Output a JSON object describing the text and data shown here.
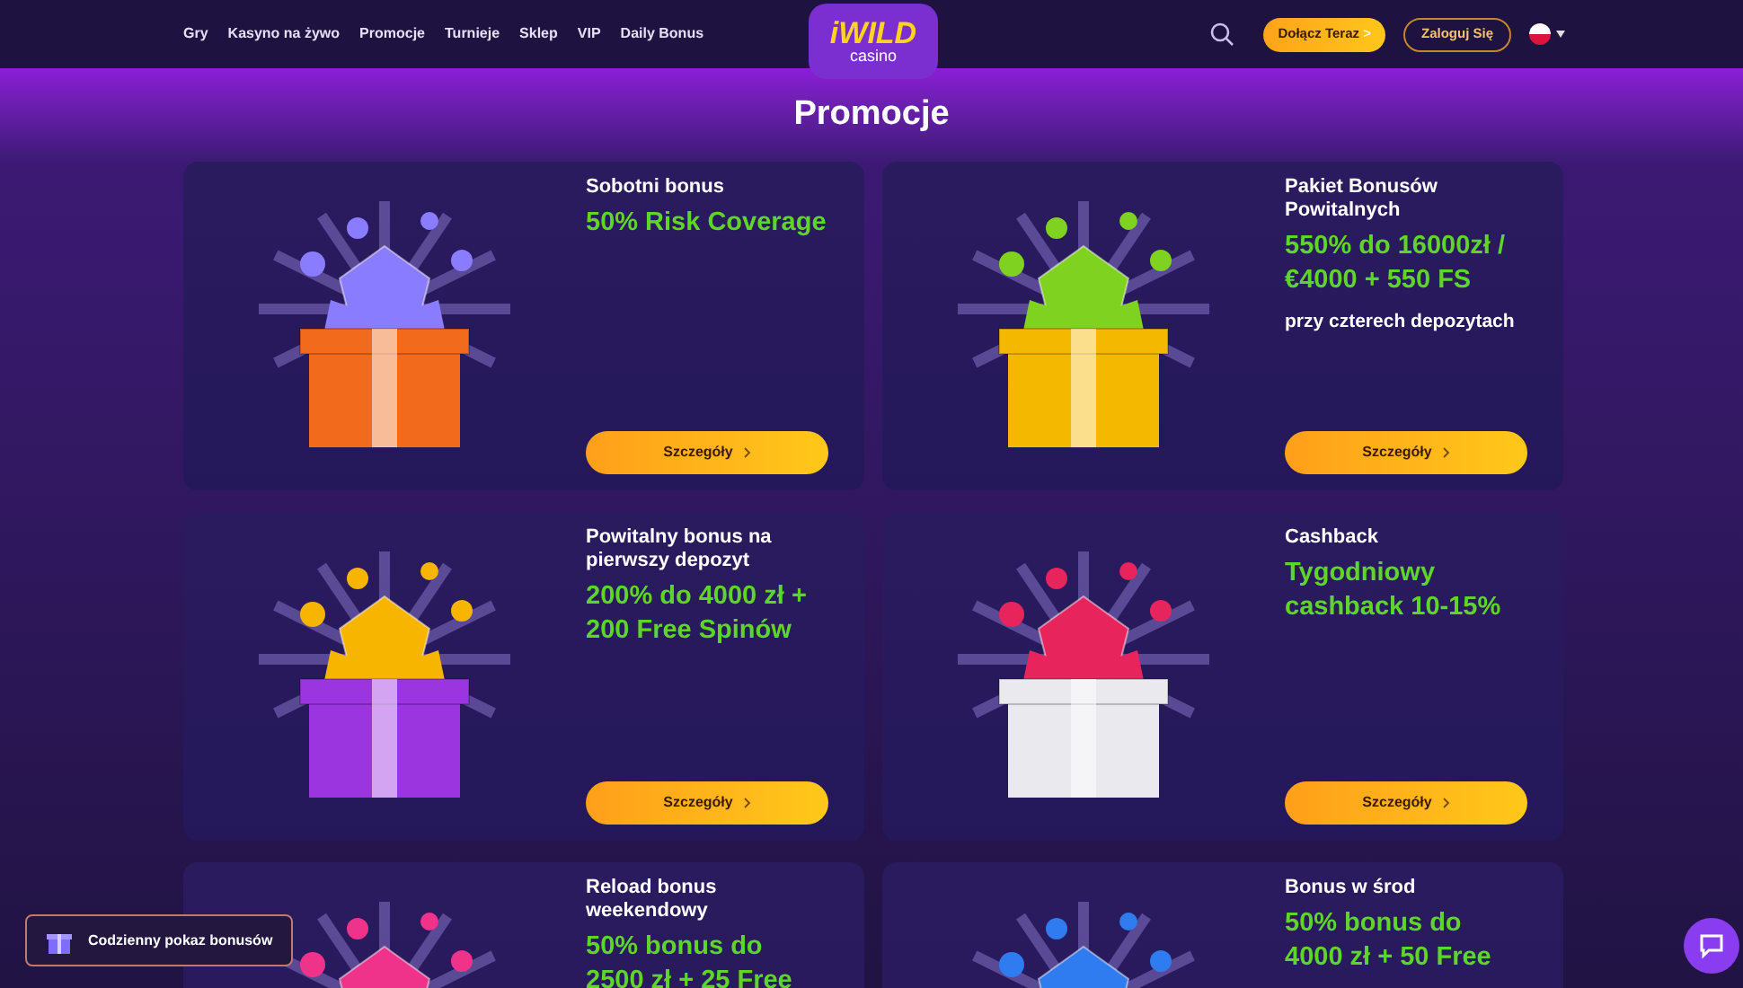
{
  "nav": {
    "links": [
      {
        "label": "Gry"
      },
      {
        "label": "Kasyno na żywo"
      },
      {
        "label": "Promocje"
      },
      {
        "label": "Turnieje"
      },
      {
        "label": "Sklep"
      },
      {
        "label": "VIP"
      },
      {
        "label": "Daily Bonus"
      }
    ],
    "logo": {
      "word": "iWILD",
      "sub": "casino"
    },
    "join_button": {
      "label": "Dołącz Teraz",
      "arrow": ">"
    },
    "login_button": {
      "label": "Zaloguj Się"
    }
  },
  "page_title": "Promocje",
  "promotions": [
    {
      "title": "Sobotni bonus",
      "offer_lines": [
        "50% Risk Coverage"
      ],
      "button": "Szczegóły"
    },
    {
      "title": "Pakiet Bonusów Powitalnych",
      "offer_lines": [
        "550% do 16000zł /",
        "€4000 + 550 FS"
      ],
      "note": "przy czterech depozytach",
      "button": "Szczegóły"
    },
    {
      "title": "Powitalny bonus na pierwszy depozyt",
      "offer_lines": [
        "200% do 4000 zł +",
        "200 Free Spinów"
      ],
      "button": "Szczegóły"
    },
    {
      "title": "Cashback",
      "offer_lines": [
        "Tygodniowy",
        "cashback 10-15%"
      ],
      "button": "Szczegóły"
    },
    {
      "title": "Reload bonus weekendowy",
      "offer_lines": [
        "50% bonus do",
        "2500 zł + 25 Free"
      ]
    },
    {
      "title": "Bonus w środ",
      "offer_lines": [
        "50% bonus do",
        "4000 zł + 50 Free"
      ]
    }
  ],
  "daily_bonus_button": {
    "label": "Codzienny pokaz bonusów"
  }
}
